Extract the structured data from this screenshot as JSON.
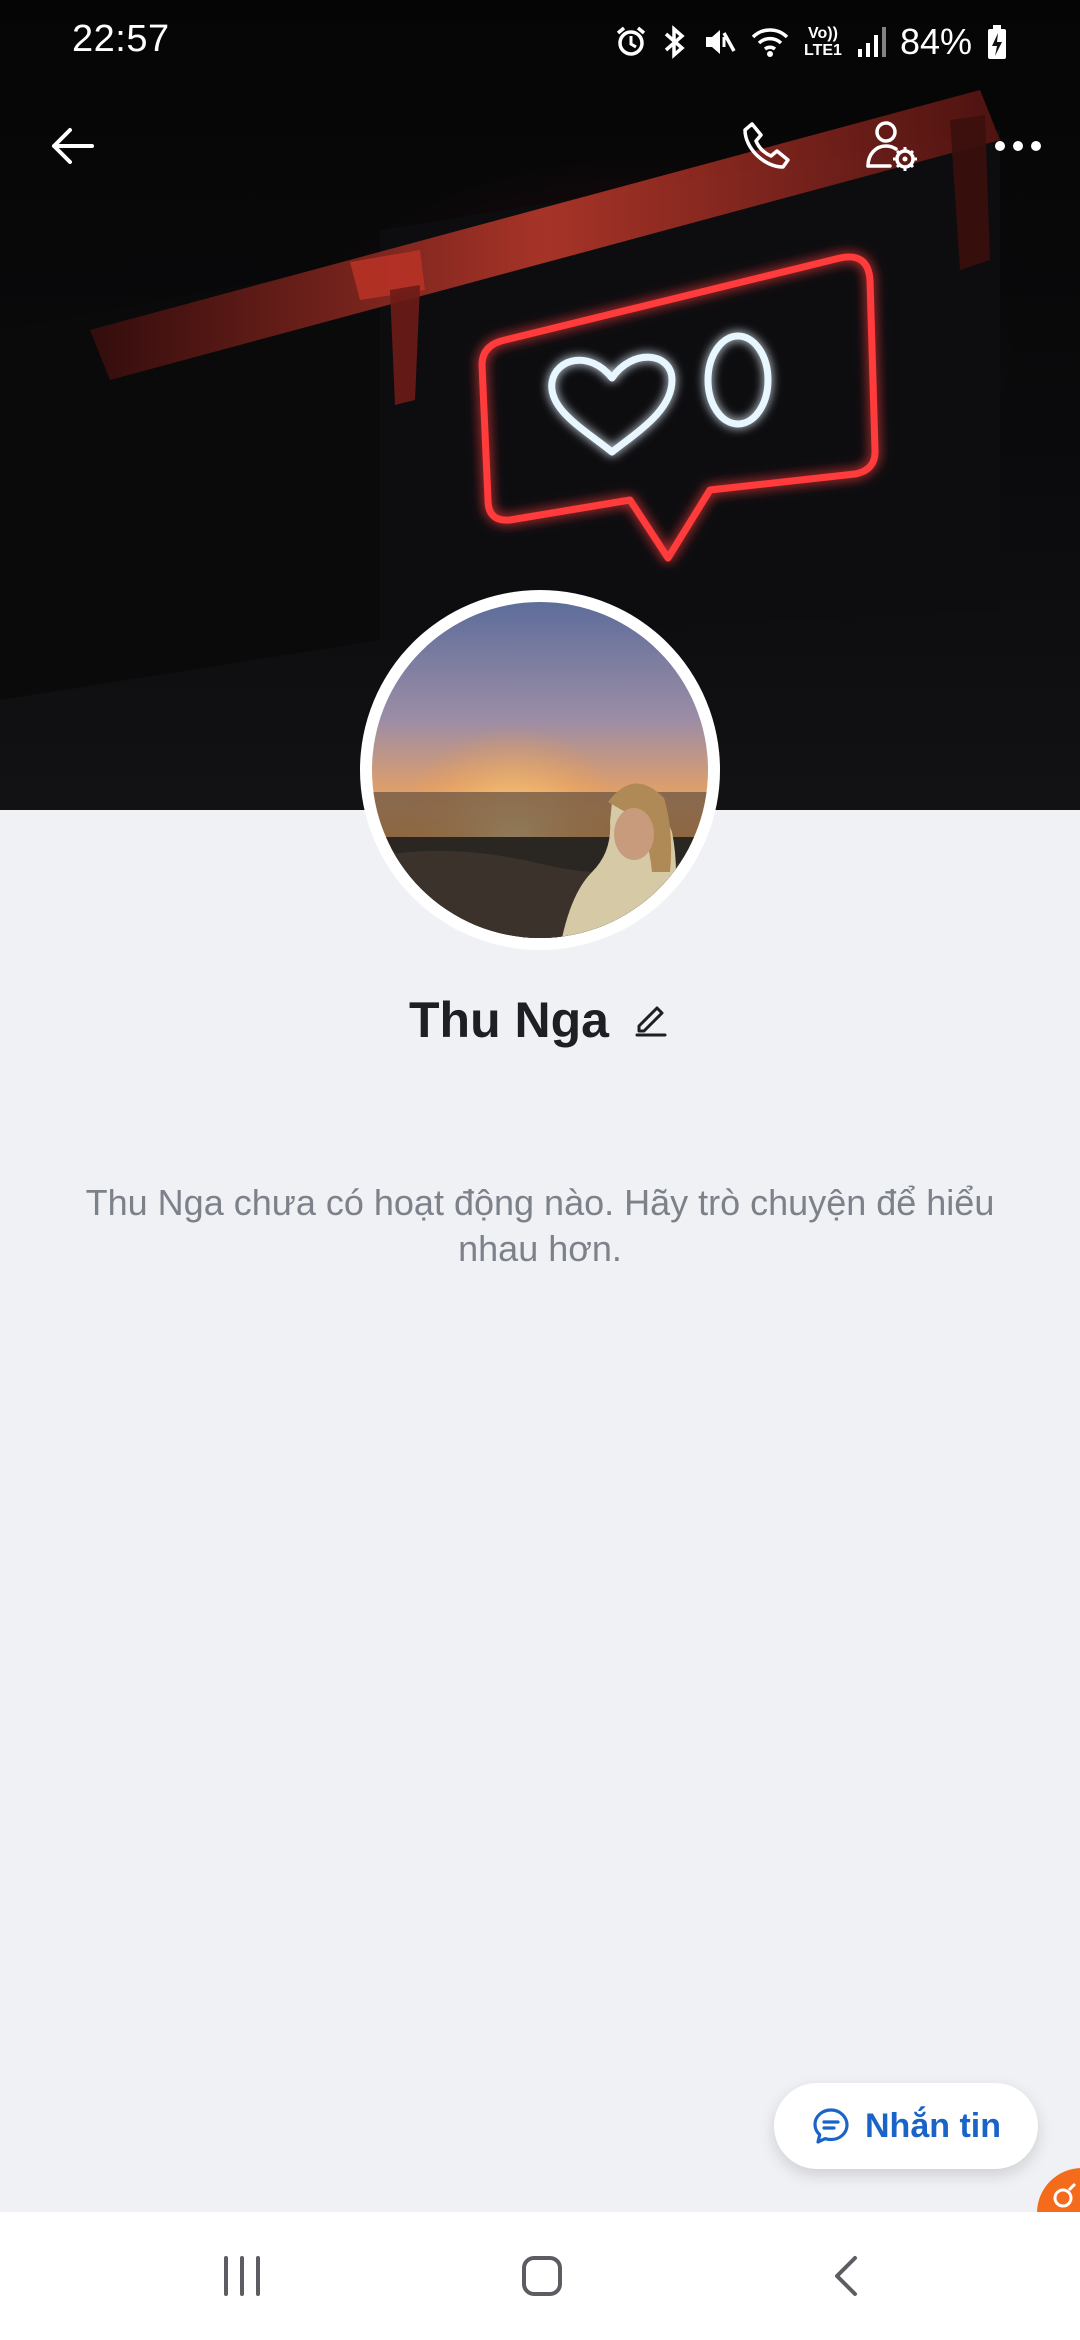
{
  "status_bar": {
    "time": "22:57",
    "battery": "84%",
    "icons": [
      "alarm-icon",
      "bluetooth-icon",
      "mute-icon",
      "wifi-icon",
      "volte-lte1-icon",
      "signal-icon",
      "battery-charging-icon"
    ],
    "network_label_top": "Vo))",
    "network_label_bottom": "LTE1"
  },
  "header": {
    "back_icon": "arrow-left-icon",
    "call_icon": "phone-icon",
    "settings_icon": "user-settings-icon",
    "more_icon": "more-dots-icon"
  },
  "cover": {
    "description_icon": "neon-like-sign",
    "like_count": "0"
  },
  "profile": {
    "name": "Thu Nga",
    "edit_icon": "pencil-icon"
  },
  "empty_state": {
    "message": "Thu Nga chưa có hoạt động nào. Hãy trò chuyện để hiểu nhau hơn."
  },
  "actions": {
    "message_label": "Nhắn tin",
    "message_icon": "chat-bubble-icon"
  },
  "nav_bar": {
    "recents_icon": "recents-icon",
    "home_icon": "home-icon",
    "back_icon": "chevron-left-icon"
  },
  "colors": {
    "accent": "#1a64c7",
    "background": "#eff1f5",
    "neon_red": "#ff3b3b",
    "neon_white": "#e8f6ff",
    "floating_badge": "#f46b1c"
  }
}
